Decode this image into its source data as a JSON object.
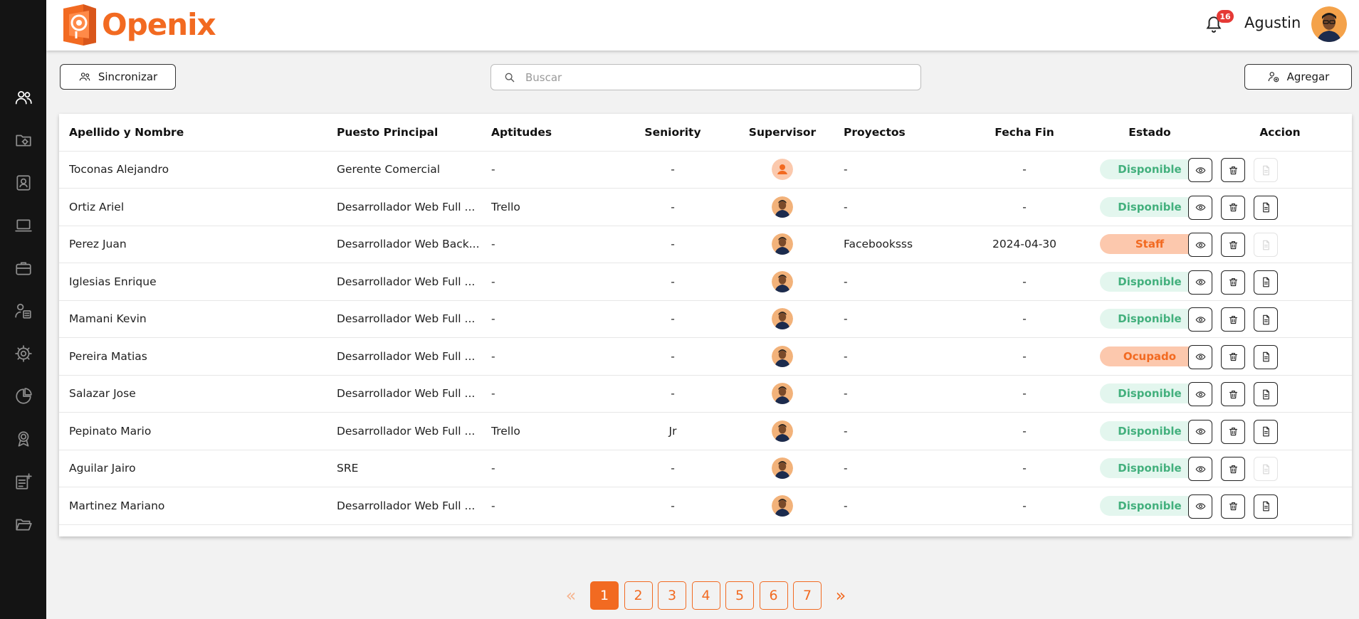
{
  "app": {
    "name": "Openix"
  },
  "colors": {
    "brand": "#f26a21",
    "available_bg": "#e3f6ee",
    "available_text": "#43b07d",
    "busy_bg": "#fcc8ad",
    "busy_text": "#f26a21"
  },
  "sidebar": {
    "items": [
      {
        "icon": "users-icon",
        "active": true
      },
      {
        "icon": "folder-gear-icon",
        "active": false
      },
      {
        "icon": "id-card-icon",
        "active": false
      },
      {
        "icon": "laptop-icon",
        "active": false
      },
      {
        "icon": "briefcase-icon",
        "active": false
      },
      {
        "icon": "user-list-icon",
        "active": false
      },
      {
        "icon": "gear-icon",
        "active": false
      },
      {
        "icon": "pie-chart-icon",
        "active": false
      },
      {
        "icon": "award-icon",
        "active": false
      },
      {
        "icon": "note-add-icon",
        "active": false
      },
      {
        "icon": "folder-open-icon",
        "active": false
      }
    ]
  },
  "header": {
    "notifications_count": "16",
    "user_name": "Agustin"
  },
  "toolbar": {
    "sync_label": "Sincronizar",
    "search_placeholder": "Buscar",
    "add_label": "Agregar"
  },
  "table": {
    "columns": [
      "Apellido y Nombre",
      "Puesto Principal",
      "Aptitudes",
      "Seniority",
      "Supervisor",
      "Proyectos",
      "Fecha Fin",
      "Estado",
      "Accion"
    ],
    "rows": [
      {
        "name": "Toconas Alejandro",
        "puesto": "Gerente Comercial",
        "aptitudes": "-",
        "seniority": "-",
        "supervisor": "placeholder",
        "proyectos": "-",
        "fecha_fin": "-",
        "estado": "Disponible",
        "estado_type": "available",
        "doc_enabled": false
      },
      {
        "name": "Ortiz Ariel",
        "puesto": "Desarrollador Web Full ...",
        "aptitudes": "Trello",
        "seniority": "-",
        "supervisor": "photo",
        "proyectos": "-",
        "fecha_fin": "-",
        "estado": "Disponible",
        "estado_type": "available",
        "doc_enabled": true
      },
      {
        "name": "Perez Juan",
        "puesto": "Desarrollador Web Back...",
        "aptitudes": "-",
        "seniority": "-",
        "supervisor": "photo",
        "proyectos": "Facebooksss",
        "fecha_fin": "2024-04-30",
        "estado": "Staff",
        "estado_type": "busy",
        "doc_enabled": false
      },
      {
        "name": "Iglesias Enrique",
        "puesto": "Desarrollador Web Full ...",
        "aptitudes": "-",
        "seniority": "-",
        "supervisor": "photo",
        "proyectos": "-",
        "fecha_fin": "-",
        "estado": "Disponible",
        "estado_type": "available",
        "doc_enabled": true
      },
      {
        "name": "Mamani Kevin",
        "puesto": "Desarrollador Web Full ...",
        "aptitudes": "-",
        "seniority": "-",
        "supervisor": "photo",
        "proyectos": "-",
        "fecha_fin": "-",
        "estado": "Disponible",
        "estado_type": "available",
        "doc_enabled": true
      },
      {
        "name": "Pereira Matias",
        "puesto": "Desarrollador Web Full ...",
        "aptitudes": "-",
        "seniority": "-",
        "supervisor": "photo",
        "proyectos": "-",
        "fecha_fin": "-",
        "estado": "Ocupado",
        "estado_type": "busy",
        "doc_enabled": true
      },
      {
        "name": "Salazar Jose",
        "puesto": "Desarrollador Web Full ...",
        "aptitudes": "-",
        "seniority": "-",
        "supervisor": "photo",
        "proyectos": "-",
        "fecha_fin": "-",
        "estado": "Disponible",
        "estado_type": "available",
        "doc_enabled": true
      },
      {
        "name": "Pepinato Mario",
        "puesto": "Desarrollador Web Full ...",
        "aptitudes": "Trello",
        "seniority": "Jr",
        "supervisor": "photo",
        "proyectos": "-",
        "fecha_fin": "-",
        "estado": "Disponible",
        "estado_type": "available",
        "doc_enabled": true
      },
      {
        "name": "Aguilar Jairo",
        "puesto": "SRE",
        "aptitudes": "-",
        "seniority": "-",
        "supervisor": "photo",
        "proyectos": "-",
        "fecha_fin": "-",
        "estado": "Disponible",
        "estado_type": "available",
        "doc_enabled": false
      },
      {
        "name": "Martinez Mariano",
        "puesto": "Desarrollador Web Full ...",
        "aptitudes": "-",
        "seniority": "-",
        "supervisor": "photo",
        "proyectos": "-",
        "fecha_fin": "-",
        "estado": "Disponible",
        "estado_type": "available",
        "doc_enabled": true
      }
    ]
  },
  "pagination": {
    "pages": [
      "1",
      "2",
      "3",
      "4",
      "5",
      "6",
      "7"
    ],
    "current": "1",
    "prev_label": "«",
    "next_label": "»"
  }
}
